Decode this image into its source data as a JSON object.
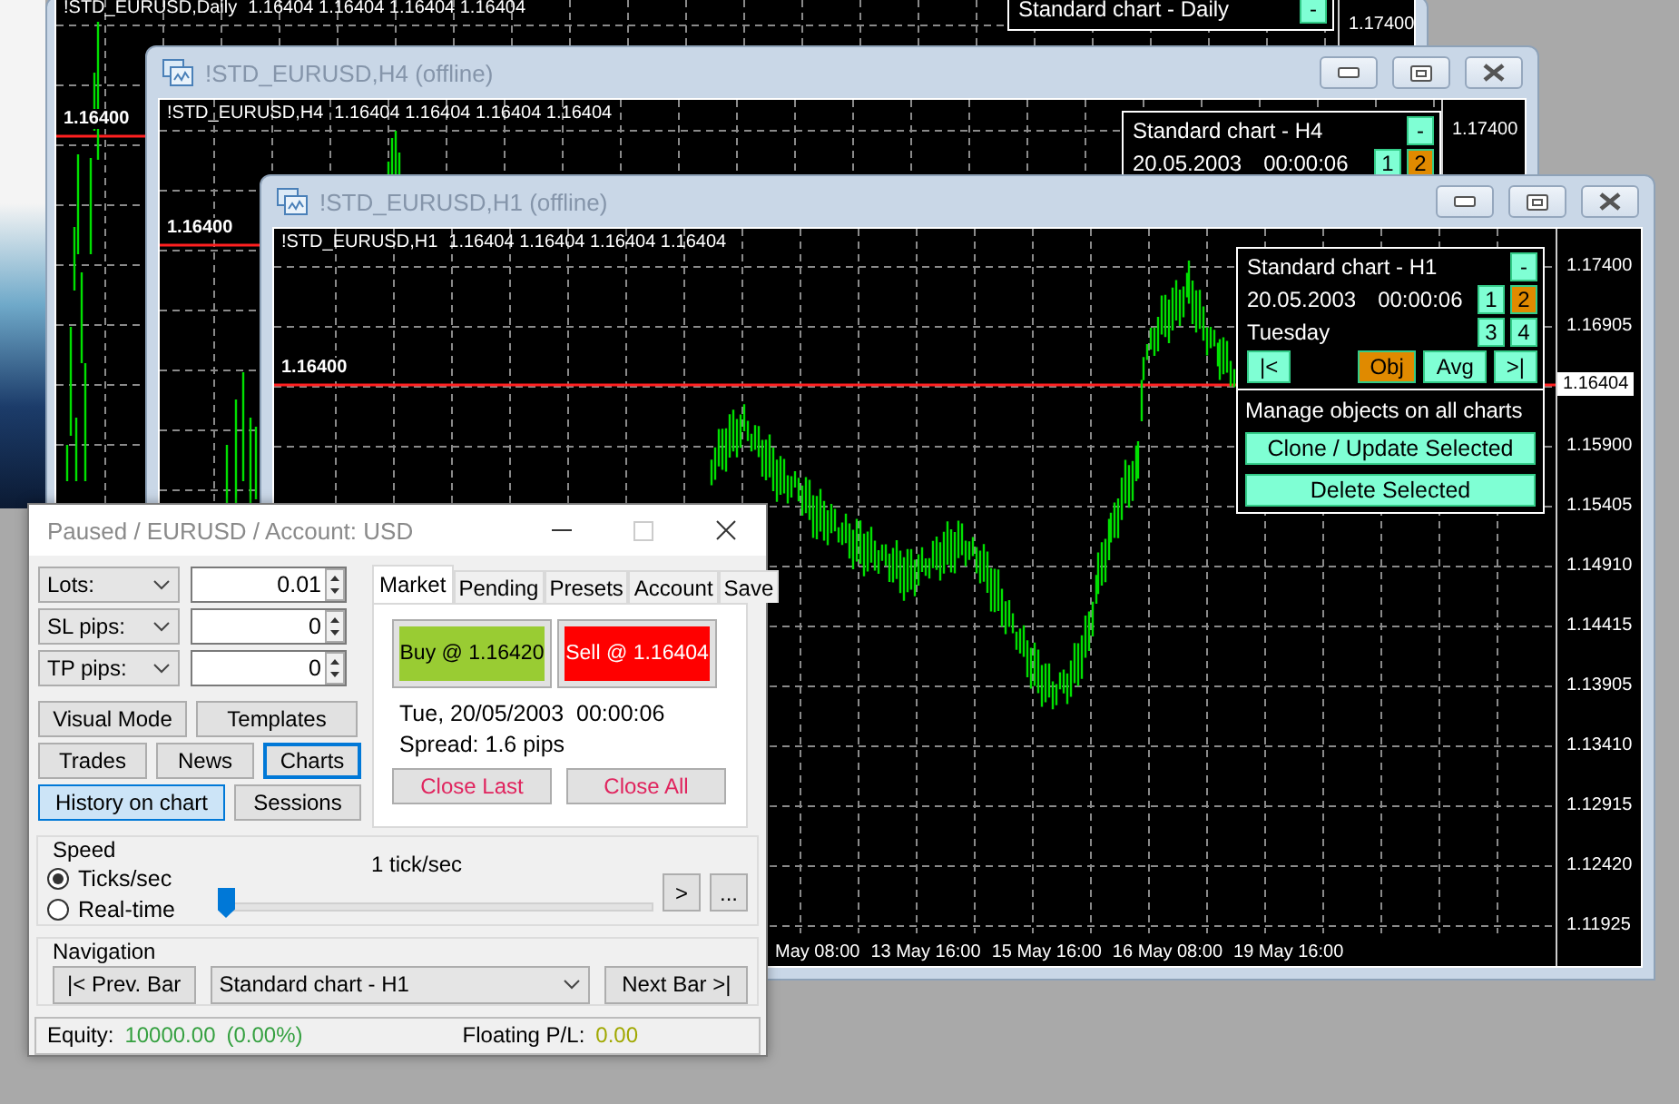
{
  "daily_window": {
    "chart_symbol": "!STD_EURUSD,Daily",
    "chart_prices": "1.16404 1.16404 1.16404 1.16404",
    "panel": {
      "title": "Standard chart - Daily",
      "collapse_button": "-"
    },
    "price_ticks": [
      "1.17400"
    ],
    "line_label": "1.16400"
  },
  "h4_window": {
    "title": "!STD_EURUSD,H4 (offline)",
    "chart_symbol": "!STD_EURUSD,H4",
    "chart_prices": "1.16404 1.16404 1.16404 1.16404",
    "panel": {
      "title": "Standard chart - H4",
      "date": "20.05.2003",
      "time": "00:00:06",
      "collapse_button": "-",
      "chart_buttons": [
        {
          "label": "1",
          "selected": false
        },
        {
          "label": "2",
          "selected": true
        }
      ]
    },
    "price_ticks": [
      "1.17400"
    ],
    "line_label": "1.16400"
  },
  "h1_window": {
    "title": "!STD_EURUSD,H1 (offline)",
    "chart_symbol": "!STD_EURUSD,H1",
    "chart_prices": "1.16404 1.16404 1.16404 1.16404",
    "panel": {
      "title": "Standard chart - H1",
      "date": "20.05.2003",
      "time": "00:00:06",
      "weekday": "Tuesday",
      "collapse_button": "-",
      "chart_buttons": [
        {
          "label": "1",
          "selected": false
        },
        {
          "label": "2",
          "selected": true
        },
        {
          "label": "3",
          "selected": false
        },
        {
          "label": "4",
          "selected": false
        }
      ],
      "nav_buttons": [
        {
          "label": "|<",
          "selected": false
        },
        {
          "label": "Obj",
          "selected": true
        },
        {
          "label": "Avg",
          "selected": false
        },
        {
          "label": ">|",
          "selected": false
        }
      ],
      "manage_label": "Manage objects on all charts",
      "action_buttons": [
        "Clone / Update Selected",
        "Delete Selected"
      ]
    },
    "price_ticks": [
      "1.17400",
      "1.16905",
      "1.15900",
      "1.15405",
      "1.14910",
      "1.14415",
      "1.13905",
      "1.13410",
      "1.12915",
      "1.12420",
      "1.11925"
    ],
    "current_price": "1.16404",
    "time_ticks": [
      "May 08:00",
      "13 May 16:00",
      "15 May 16:00",
      "16 May 08:00",
      "19 May 16:00"
    ],
    "line_label": "1.16400"
  },
  "tester": {
    "title": "Paused / EURUSD / Account: USD",
    "params": [
      {
        "label": "Lots:",
        "value": "0.01"
      },
      {
        "label": "SL pips:",
        "value": "0"
      },
      {
        "label": "TP pips:",
        "value": "0"
      }
    ],
    "buttons": [
      {
        "label": "Visual Mode",
        "selected": false,
        "focused": false
      },
      {
        "label": "Templates",
        "selected": false,
        "focused": false
      },
      {
        "label": "Trades",
        "selected": false,
        "focused": false
      },
      {
        "label": "News",
        "selected": false,
        "focused": false
      },
      {
        "label": "Charts",
        "selected": false,
        "focused": true
      },
      {
        "label": "History on chart",
        "selected": true,
        "focused": false
      },
      {
        "label": "Sessions",
        "selected": false,
        "focused": false
      }
    ],
    "tabs": [
      {
        "label": "Market",
        "selected": true
      },
      {
        "label": "Pending",
        "selected": false
      },
      {
        "label": "Presets",
        "selected": false
      },
      {
        "label": "Account",
        "selected": false
      },
      {
        "label": "Save",
        "selected": false
      }
    ],
    "trade_buttons": [
      {
        "kind": "buy",
        "label": "Buy @ 1.16420"
      },
      {
        "kind": "sell",
        "label": "Sell @ 1.16404"
      }
    ],
    "datetime": "Tue, 20/05/2003  00:00:06",
    "spread": "Spread: 1.6 pips",
    "close_buttons": [
      "Close Last",
      "Close All"
    ],
    "speed": {
      "title": "Speed",
      "reading": "1 tick/sec",
      "modes": [
        {
          "label": "Ticks/sec",
          "selected": true
        },
        {
          "label": "Real-time",
          "selected": false
        }
      ],
      "level": 0.0,
      "buttons": [
        ">",
        "..."
      ]
    },
    "navigation": {
      "title": "Navigation",
      "prev_button": "|< Prev. Bar",
      "chart_select": "Standard chart - H1",
      "next_button": "Next Bar >|"
    },
    "status": {
      "equity_label": "Equity:",
      "equity": "10000.00",
      "equity_change": "(0.00%)",
      "pl_label": "Floating P/L:",
      "pl": "0.00"
    }
  }
}
